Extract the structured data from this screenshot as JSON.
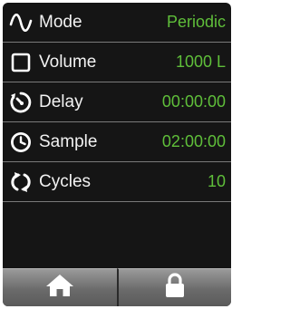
{
  "rows": [
    {
      "label": "Mode",
      "value": "Periodic",
      "icon": "sine-wave-icon"
    },
    {
      "label": "Volume",
      "value": "1000 L",
      "icon": "square-outline-icon"
    },
    {
      "label": "Delay",
      "value": "00:00:00",
      "icon": "timer-icon"
    },
    {
      "label": "Sample",
      "value": "02:00:00",
      "icon": "clock-icon"
    },
    {
      "label": "Cycles",
      "value": "10",
      "icon": "cycle-arrows-icon"
    },
    {
      "label": "",
      "value": "",
      "icon": ""
    }
  ],
  "toolbar": {
    "home_icon": "home-icon",
    "lock_icon": "lock-icon"
  },
  "colors": {
    "background": "#151515",
    "label": "#f2f2f2",
    "value": "#5fbf3a",
    "divider": "#7a7a7a"
  }
}
